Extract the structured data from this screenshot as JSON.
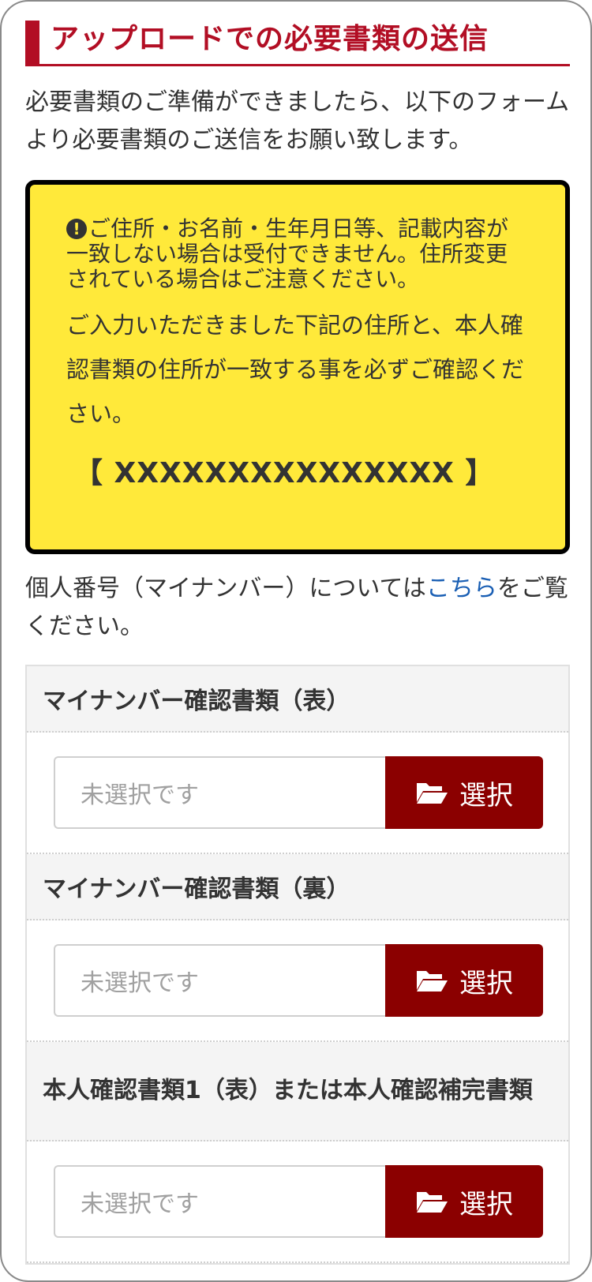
{
  "page": {
    "title": "アップロードでの必要書類の送信",
    "intro": "必要書類のご準備ができましたら、以下のフォームより必要書類のご送信をお願い致します。"
  },
  "notice": {
    "warning": "ご住所・お名前・生年月日等、記載内容が一致しない場合は受付できません。住所変更されている場合はご注意ください。",
    "confirm": "ご入力いただきました下記の住所と、本人確認書類の住所が一致する事を必ずご確認ください。",
    "address": "【 XXXXXXXXXXXXXXX 】",
    "background_color": "#ffe93a"
  },
  "mynumber_info": {
    "before": "個人番号（マイナンバー）については",
    "link": "こちら",
    "after": "をご覧ください。"
  },
  "uploads": [
    {
      "label": "マイナンバー確認書類（表）",
      "status": "未選択です",
      "button": "選択"
    },
    {
      "label": "マイナンバー確認書類（裏）",
      "status": "未選択です",
      "button": "選択"
    },
    {
      "label": "本人確認書類1（表）または本人確認補完書類",
      "status": "未選択です",
      "button": "選択"
    }
  ],
  "colors": {
    "brand_red": "#b20e24",
    "button_red": "#8b0000",
    "link_blue": "#1a5fb4"
  },
  "icons": {
    "folder": "folder-open-icon",
    "alert": "exclamation-circle-icon"
  }
}
